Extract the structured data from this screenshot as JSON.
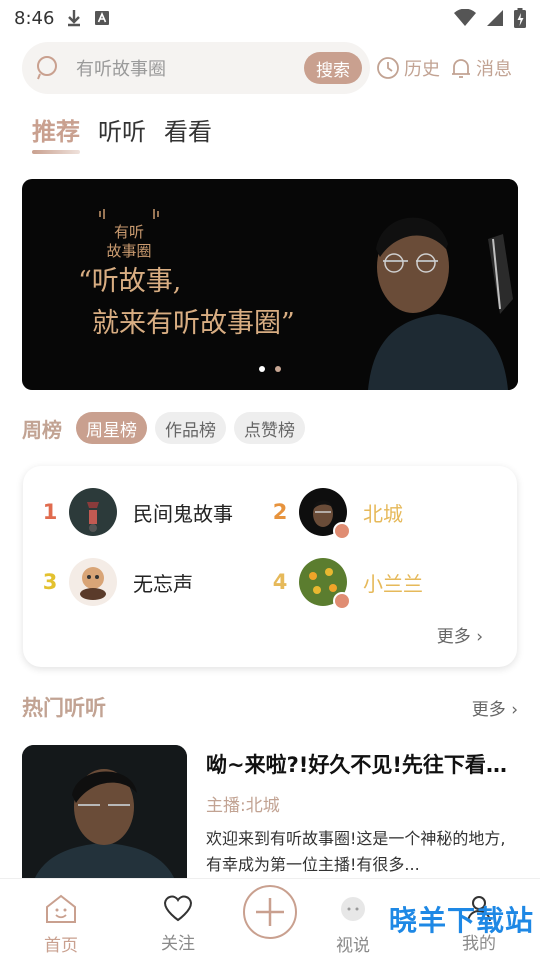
{
  "status_bar": {
    "time": "8:46"
  },
  "search": {
    "placeholder": "有听故事圈",
    "button_label": "搜索"
  },
  "header_actions": {
    "history_label": "历史",
    "messages_label": "消息"
  },
  "tabs": [
    {
      "label": "推荐",
      "active": true
    },
    {
      "label": "听听",
      "active": false
    },
    {
      "label": "看看",
      "active": false
    }
  ],
  "banner": {
    "logo_line1": "有听",
    "logo_line2": "故事圈",
    "quote_line1": "“听故事,",
    "quote_line2": "就来有听故事圈”",
    "page_count": 2,
    "current_page": 1
  },
  "weekly": {
    "title": "周榜",
    "chips": [
      {
        "label": "周星榜",
        "active": true
      },
      {
        "label": "作品榜",
        "active": false
      },
      {
        "label": "点赞榜",
        "active": false
      }
    ],
    "items": [
      {
        "rank": "1",
        "name": "民间鬼故事"
      },
      {
        "rank": "2",
        "name": "北城"
      },
      {
        "rank": "3",
        "name": "无忘声"
      },
      {
        "rank": "4",
        "name": "小兰兰"
      }
    ],
    "more_label": "更多"
  },
  "hot": {
    "title": "热门听听",
    "more_label": "更多",
    "item": {
      "title": "呦~来啦?!好久不见!先往下看看吧",
      "host": "主播:北城",
      "description": "欢迎来到有听故事圈!这是一个神秘的地方,有幸成为第一位主播!有很多..."
    }
  },
  "bottom_nav": {
    "home_label": "首页",
    "follow_label": "关注",
    "watch_label": "视说",
    "mine_label": "我的"
  },
  "watermark": "晓羊下载站",
  "colors": {
    "accent": "#c9a08f",
    "accent_text": "#c2a393",
    "rank1": "#e06b4e",
    "rank2": "#e7933d",
    "rank3": "#e3c12f",
    "rank4": "#e6b95a"
  }
}
